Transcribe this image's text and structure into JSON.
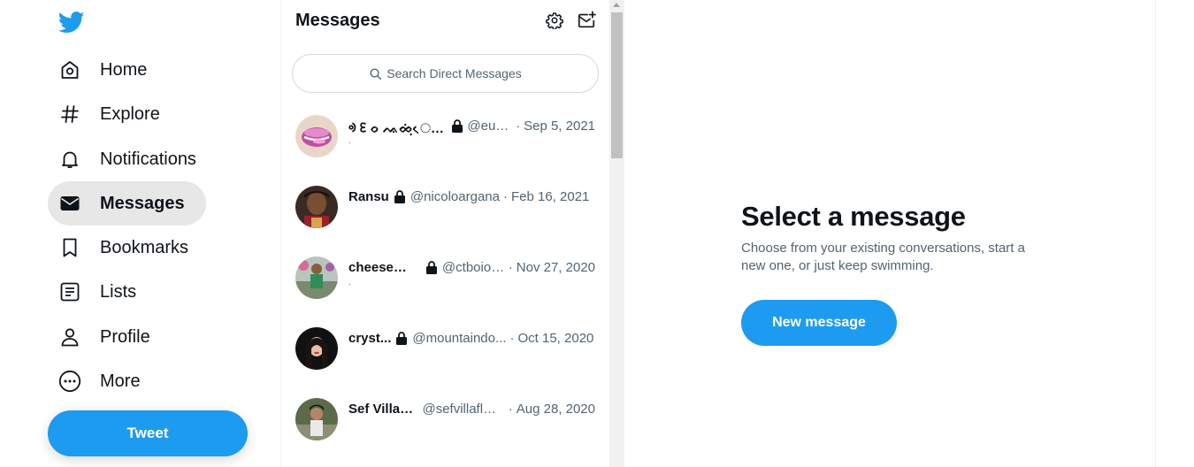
{
  "nav": {
    "items": [
      {
        "label": "Home",
        "icon": "home-icon"
      },
      {
        "label": "Explore",
        "icon": "hashtag-icon"
      },
      {
        "label": "Notifications",
        "icon": "bell-icon"
      },
      {
        "label": "Messages",
        "icon": "envelope-icon",
        "active": true
      },
      {
        "label": "Bookmarks",
        "icon": "bookmark-icon"
      },
      {
        "label": "Lists",
        "icon": "list-icon"
      },
      {
        "label": "Profile",
        "icon": "person-icon"
      },
      {
        "label": "More",
        "icon": "more-circle-icon"
      }
    ],
    "tweet_label": "Tweet"
  },
  "messages": {
    "title": "Messages",
    "search_placeholder": "Search Direct Messages",
    "conversations": [
      {
        "name": "ᢀ ᢄ ᨔ ᨕᨖᨘᨗᨙ ᨚ ...",
        "handle": "@euni...",
        "date": "Sep 5, 2021",
        "preview": "."
      },
      {
        "name": "Ransu",
        "handle": "@nicoloargana",
        "date": "Feb 16, 2021",
        "preview": ""
      },
      {
        "name": "cheeseK...",
        "handle": "@ctboiol...",
        "date": "Nov 27, 2020",
        "preview": "."
      },
      {
        "name": "cryst...",
        "handle": "@mountaindo...",
        "date": "Oct 15, 2020",
        "preview": ""
      },
      {
        "name": "Sef Villaf...",
        "handle": "@sefvillaflo...",
        "date": "Aug 28, 2020",
        "preview": ""
      }
    ]
  },
  "detail": {
    "title": "Select a message",
    "subtitle": "Choose from your existing conversations, start a new one, or just keep swimming.",
    "new_message_label": "New message"
  },
  "colors": {
    "brand": "#1d9bf0",
    "text": "#0f1419",
    "muted": "#536471",
    "active_bg": "#e7e7e8"
  }
}
